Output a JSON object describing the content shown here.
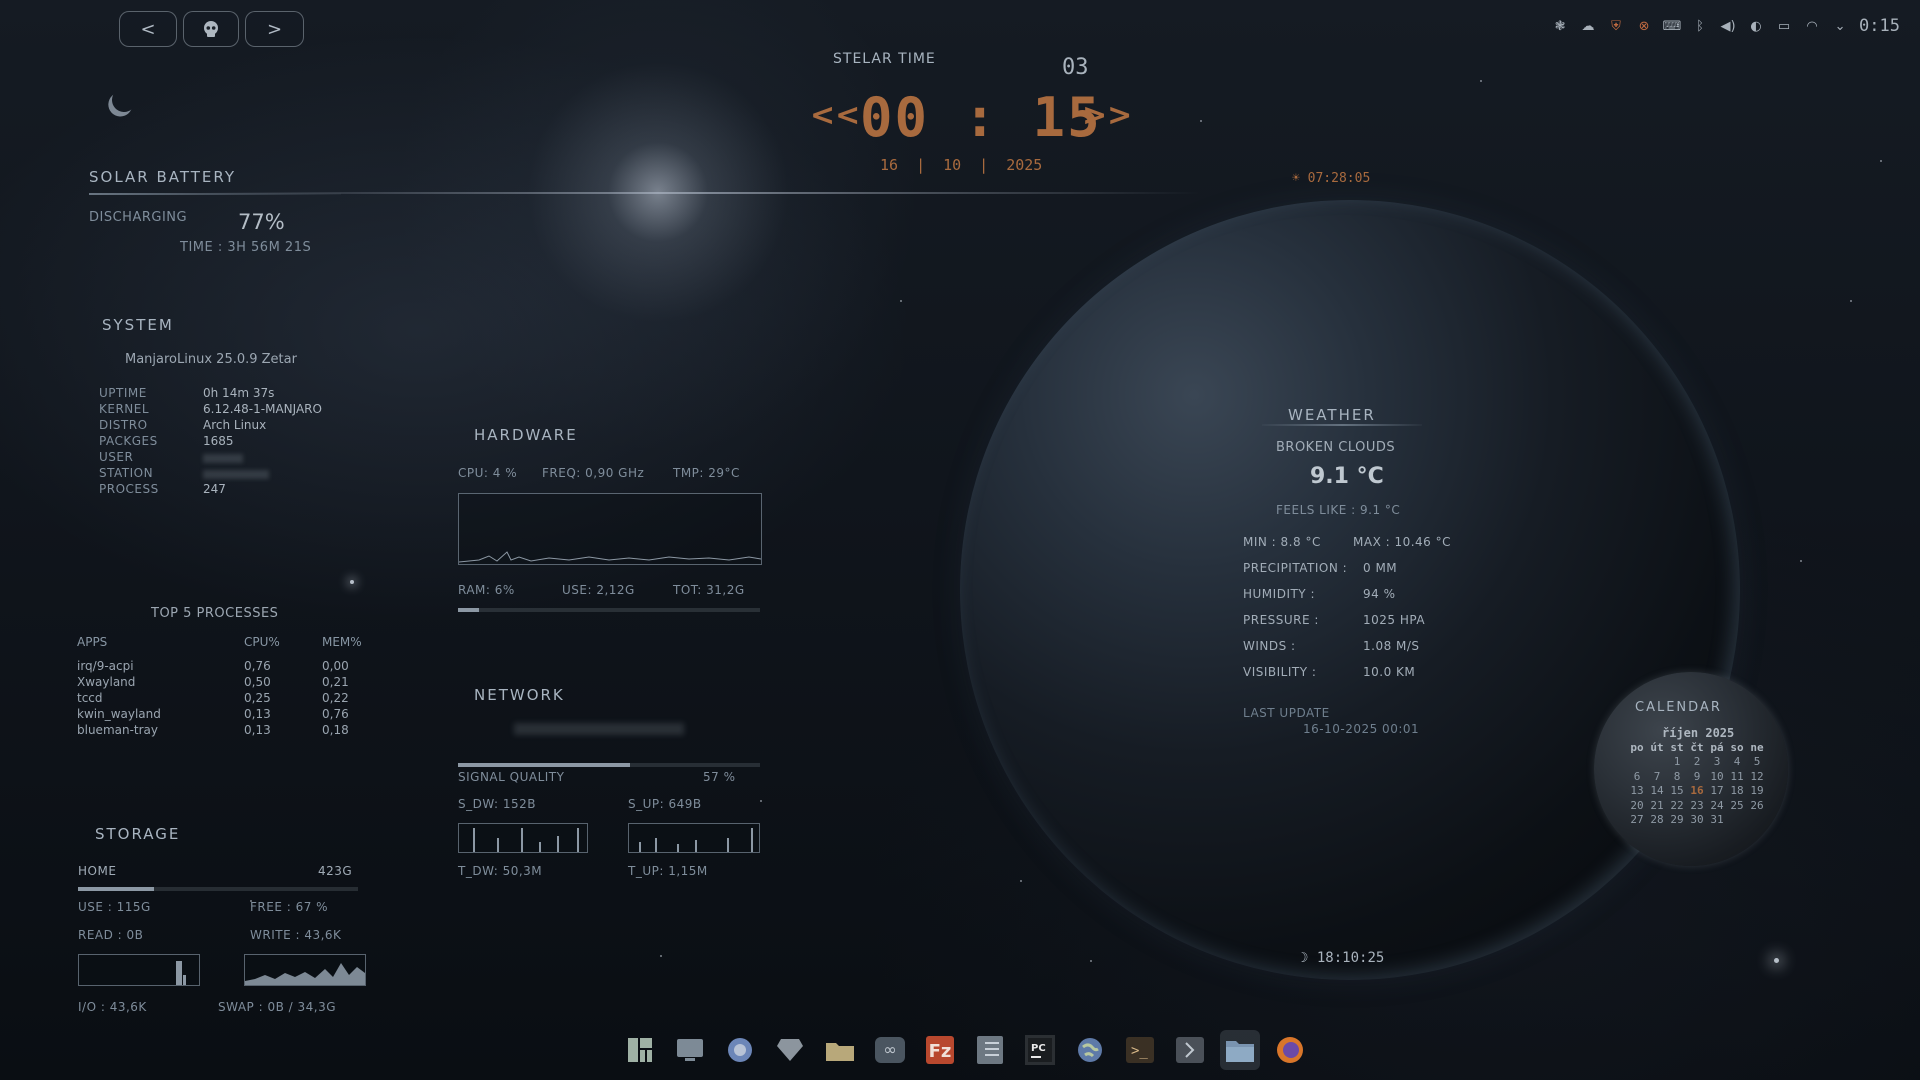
{
  "nav": {
    "back_label": "<",
    "forward_label": ">"
  },
  "tray": {
    "clock": "0:15"
  },
  "stellar": {
    "title": "STELAR TIME",
    "day_num": "03",
    "left_arrows": "<<",
    "right_arrows": ">>",
    "time": "00 : 15",
    "date_day": "16",
    "date_month": "10",
    "date_year": "2025",
    "sep": "|"
  },
  "sunrise": "07:28:05",
  "sunset": "18:10:25",
  "battery": {
    "title": "SOLAR BATTERY",
    "status": "DISCHARGING",
    "percent": "77%",
    "percent_value": 0.77,
    "time": "TIME : 3H 56M 21S"
  },
  "system": {
    "title": "SYSTEM",
    "os": "ManjaroLinux 25.0.9 Zetar",
    "rows": [
      {
        "label": "UPTIME",
        "value": "0h 14m 37s"
      },
      {
        "label": "KERNEL",
        "value": "6.12.48-1-MANJARO"
      },
      {
        "label": "DISTRO",
        "value": "Arch Linux"
      },
      {
        "label": "PACKGES",
        "value": "1685"
      },
      {
        "label": "USER",
        "value": ""
      },
      {
        "label": "STATION",
        "value": ""
      },
      {
        "label": "PROCESS",
        "value": "247"
      }
    ]
  },
  "processes": {
    "title": "TOP 5 PROCESSES",
    "headers": [
      "APPS",
      "CPU%",
      "MEM%"
    ],
    "rows": [
      {
        "app": "irq/9-acpi",
        "cpu": "0,76",
        "mem": "0,00"
      },
      {
        "app": "Xwayland",
        "cpu": "0,50",
        "mem": "0,21"
      },
      {
        "app": "tccd",
        "cpu": "0,25",
        "mem": "0,22"
      },
      {
        "app": "kwin_wayland",
        "cpu": "0,13",
        "mem": "0,76"
      },
      {
        "app": "blueman-tray",
        "cpu": "0,13",
        "mem": "0,18"
      }
    ]
  },
  "storage": {
    "title": "STORAGE",
    "home_label": "HOME",
    "home_size": "423G",
    "used_fraction": 0.27,
    "use": "USE : 115G",
    "free": "FREE : 67 %",
    "read": "READ : 0B",
    "write": "WRITE : 43,6K",
    "io": "I/O : 43,6K",
    "swap": "SWAP : 0B / 34,3G"
  },
  "hardware": {
    "title": "HARDWARE",
    "cpu": "CPU: 4 %",
    "freq": "FREQ: 0,90 GHz",
    "tmp": "TMP: 29°C",
    "ram": "RAM: 6%",
    "use": "USE: 2,12G",
    "tot": "TOT: 31,2G",
    "ram_fraction": 0.07
  },
  "network": {
    "title": "NETWORK",
    "signal_label": "SIGNAL QUALITY",
    "signal_value": "57 %",
    "signal_fraction": 0.57,
    "s_dw": "S_DW: 152B",
    "s_up": "S_UP: 649B",
    "t_dw": "T_DW: 50,3M",
    "t_up": "T_UP: 1,15M"
  },
  "weather": {
    "title": "WEATHER",
    "condition": "BROKEN CLOUDS",
    "temp": "9.1 °C",
    "feels_like": "FEELS LIKE : 9.1 °C",
    "min": "MIN : 8.8 °C",
    "max": "MAX : 10.46 °C",
    "rows": [
      {
        "label": "PRECIPITATION :",
        "value": "0 MM"
      },
      {
        "label": "HUMIDITY :",
        "value": "94 %"
      },
      {
        "label": "PRESSURE :",
        "value": "1025 HPA"
      },
      {
        "label": "WINDS :",
        "value": "1.08 M/S"
      },
      {
        "label": "VISIBILITY :",
        "value": "10.0 KM"
      }
    ],
    "last_update_label": "LAST UPDATE",
    "last_update": "16-10-2025 00:01"
  },
  "calendar": {
    "title": "CALENDAR",
    "month": "říjen 2025",
    "weekdays": [
      "po",
      "út",
      "st",
      "čt",
      "pá",
      "so",
      "ne"
    ],
    "weeks": [
      [
        "",
        "",
        "1",
        "2",
        "3",
        "4",
        "5"
      ],
      [
        "6",
        "7",
        "8",
        "9",
        "10",
        "11",
        "12"
      ],
      [
        "13",
        "14",
        "15",
        "16",
        "17",
        "18",
        "19"
      ],
      [
        "20",
        "21",
        "22",
        "23",
        "24",
        "25",
        "26"
      ],
      [
        "27",
        "28",
        "29",
        "30",
        "31",
        "",
        ""
      ]
    ],
    "today": "16"
  },
  "taskbar": {
    "icons": [
      "manjaro-icon",
      "desktop-icon",
      "browser-icon",
      "gem-icon",
      "folder-icon",
      "infinity-icon",
      "filezilla-icon",
      "notes-icon",
      "pycharm-icon",
      "globe-icon",
      "terminal-icon",
      "run-icon",
      "files-icon",
      "firefox-icon"
    ]
  },
  "colors": {
    "accent": "#a86a3e",
    "text": "#a9b3bd"
  }
}
